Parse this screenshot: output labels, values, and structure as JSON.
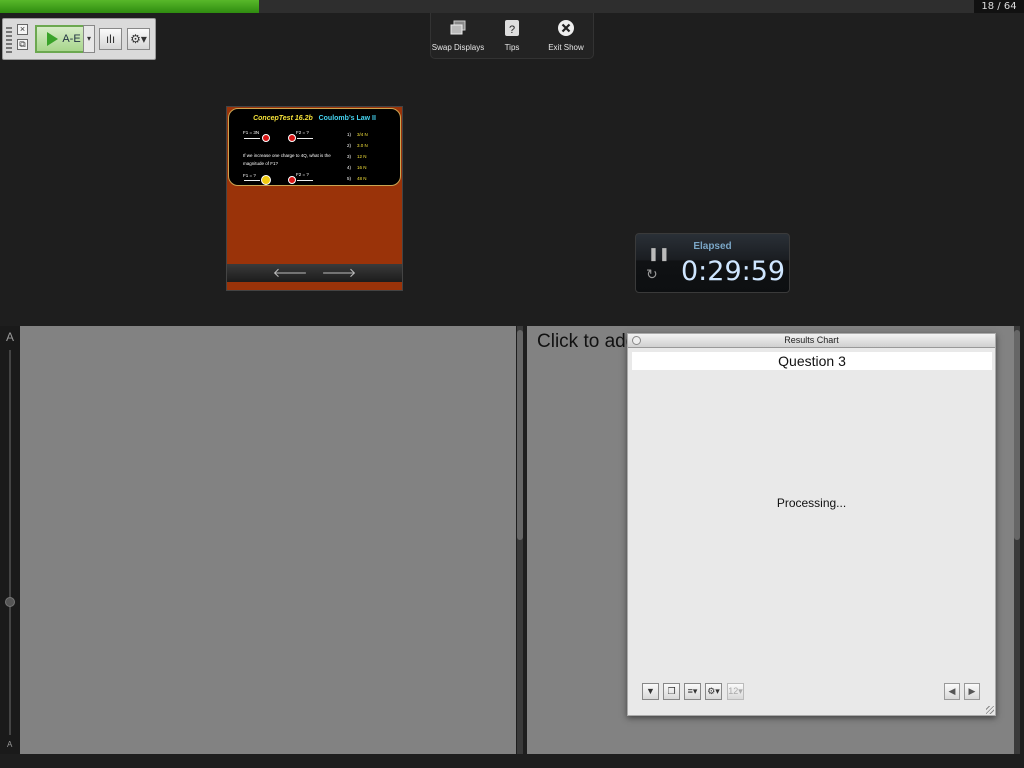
{
  "progress": {
    "fraction": 0.266,
    "counter": "18 / 64",
    "fill_color": "#4caf27"
  },
  "toolbar": {
    "close_icon": "close-icon",
    "copy_icon": "copy-icon",
    "play_label": "A-E",
    "dropdown_glyph": "▾",
    "chart_glyph": "ılı",
    "settings_glyph": "⚙▾"
  },
  "top_menu": {
    "swap": "Swap Displays",
    "tips": "Tips",
    "exit": "Exit Show"
  },
  "slide": {
    "title_a": "ConcepTest 16.2b",
    "title_b": "Coulomb’s Law II",
    "f1_top": "F1 = 3N",
    "f2_top": "F2 = ?",
    "q_label": "Q",
    "q_big_label": "4Q",
    "question": "If we increase one charge to 4Q, what is the magnitude of F1?",
    "f1_bottom": "F1 = ?",
    "f2_bottom": "F2 = ?",
    "answers": [
      {
        "n": "1)",
        "v": "3/4 N"
      },
      {
        "n": "2)",
        "v": "3.0 N"
      },
      {
        "n": "3)",
        "v": "12 N"
      },
      {
        "n": "4)",
        "v": "16 N"
      },
      {
        "n": "5)",
        "v": "48 N"
      }
    ],
    "nav_prev": "🡐",
    "nav_next": "🡒"
  },
  "timer": {
    "label": "Elapsed",
    "value": "0:29:59",
    "pause_glyph": "❚❚",
    "reset_glyph": "↻"
  },
  "side": {
    "top_letter": "A",
    "bottom_letter": "A"
  },
  "right_panel": {
    "click_to_add": "Click to add"
  },
  "results_chart": {
    "title": "Results Chart",
    "question": "Question 3",
    "status": "Processing...",
    "tools": [
      "▼",
      "❐",
      "≡▾",
      "⚙▾",
      "12▾"
    ],
    "prev": "◀",
    "next": "▶"
  }
}
